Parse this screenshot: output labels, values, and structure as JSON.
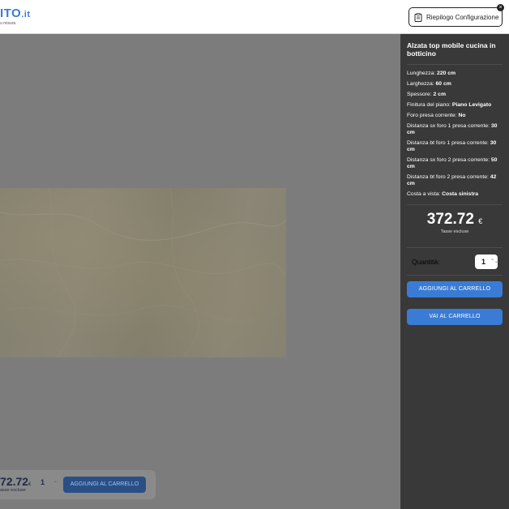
{
  "header": {
    "logo_text": "ITO",
    "logo_suffix": ".it",
    "logo_subtitle": "u misura",
    "recap_button": "Riepilogo Configurazione",
    "close_badge": "×"
  },
  "preview": {
    "bottom_bar": {
      "price": "72.72",
      "currency": "€",
      "tax_note": "asse escluse",
      "quantity": "1",
      "add_button": "AGGIUNGI AL CARRELLO"
    }
  },
  "sidebar": {
    "title": "Alzata top mobile cucina in botticino",
    "specs": [
      {
        "label": "Lunghezza: ",
        "value": "220 cm"
      },
      {
        "label": "Larghezza: ",
        "value": "60 cm"
      },
      {
        "label": "Spessore: ",
        "value": "2 cm"
      },
      {
        "label": "Finitura del piano: ",
        "value": "Piano Levigato"
      },
      {
        "label": "Foro presa corrente: ",
        "value": "No"
      },
      {
        "label": "Distanza sx foro 1 presa corrente: ",
        "value": "30 cm"
      },
      {
        "label": "Distanza bt foro 1 presa corrente: ",
        "value": "30 cm"
      },
      {
        "label": "Distanza sx foro 2 presa corrente: ",
        "value": "50 cm"
      },
      {
        "label": "Distanza bt foro 2 presa corrente: ",
        "value": "42 cm"
      },
      {
        "label": "Costa a vista: ",
        "value": "Costa sinistra"
      }
    ],
    "price": "372.72",
    "currency": "€",
    "tax_note": "Tasse escluse",
    "quantity_label": "Quantità:",
    "quantity": "1",
    "add_to_cart": "AGGIUNGI AL CARRELLO",
    "go_to_cart": "VAI AL CARRELLO"
  },
  "colors": {
    "accent": "#3a7bd5",
    "sidebar_bg": "#393939",
    "overlay": "#7d7d7d"
  }
}
